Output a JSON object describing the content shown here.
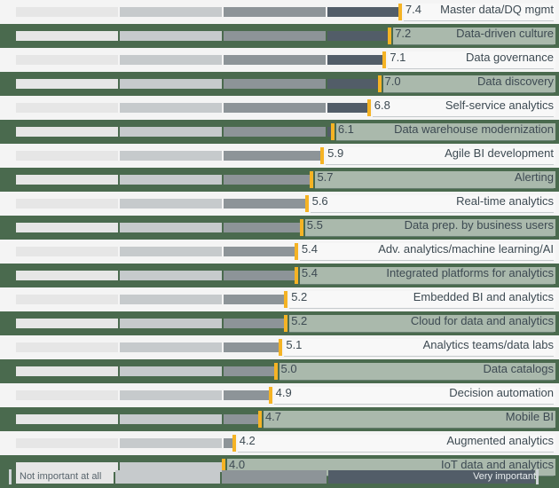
{
  "colors": {
    "background_green": "#4a6a4e",
    "row_light": "#f4f4f4",
    "segment_1": "#e6e6e6",
    "segment_2": "#c6cacc",
    "segment_3": "#8d9498",
    "segment_4": "#525d68",
    "marker": "#f5b324",
    "text": "#3d4a52"
  },
  "legend": {
    "low_label": "Not important at all",
    "high_label": "Very important"
  },
  "chart_data": {
    "type": "bar",
    "title": "",
    "xlabel": "",
    "ylabel": "",
    "xlim": [
      0,
      10
    ],
    "grid": false,
    "legend_position": "bottom",
    "scale_low_label": "Not important at all",
    "scale_high_label": "Very important",
    "scale_bands": [
      {
        "from": 0.0,
        "to": 2.0,
        "color": "#e6e6e6"
      },
      {
        "from": 2.0,
        "to": 4.0,
        "color": "#c6cacc"
      },
      {
        "from": 4.0,
        "to": 6.0,
        "color": "#8d9498"
      },
      {
        "from": 6.0,
        "to": 10.0,
        "color": "#525d68"
      }
    ],
    "categories": [
      "Master data/DQ mgmt",
      "Data-driven culture",
      "Data governance",
      "Data discovery",
      "Self-service analytics",
      "Data warehouse modernization",
      "Agile BI development",
      "Alerting",
      "Real-time analytics",
      "Data prep. by business users",
      "Adv. analytics/machine learning/AI",
      "Integrated platforms for analytics",
      "Embedded BI and analytics",
      "Cloud for data and analytics",
      "Analytics teams/data labs",
      "Data catalogs",
      "Decision automation",
      "Mobile BI",
      "Augmented analytics",
      "IoT data and analytics"
    ],
    "values": [
      7.4,
      7.2,
      7.1,
      7.0,
      6.8,
      6.1,
      5.9,
      5.7,
      5.6,
      5.5,
      5.4,
      5.4,
      5.2,
      5.2,
      5.1,
      5.0,
      4.9,
      4.7,
      4.2,
      4.0
    ],
    "value_labels": [
      "7.4",
      "7.2",
      "7.1",
      "7.0",
      "6.8",
      "6.1",
      "5.9",
      "5.7",
      "5.6",
      "5.5",
      "5.4",
      "5.4",
      "5.2",
      "5.2",
      "5.1",
      "5.0",
      "4.9",
      "4.7",
      "4.2",
      "4.0"
    ]
  }
}
